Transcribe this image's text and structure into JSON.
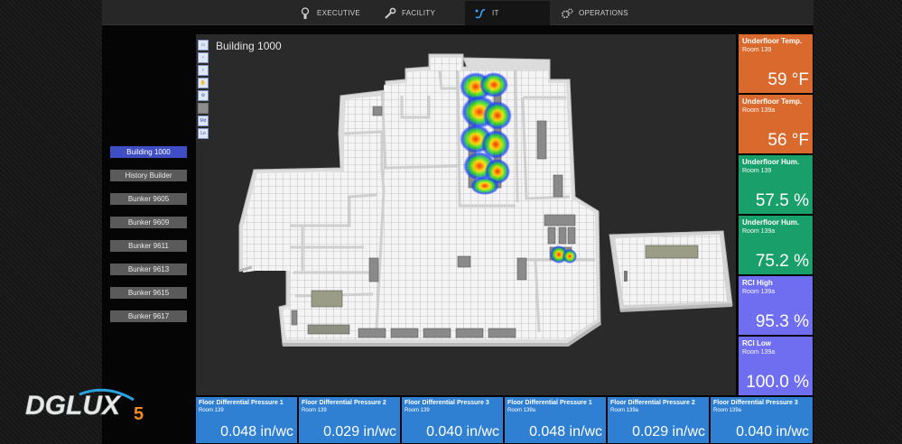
{
  "nav": {
    "tabs": [
      {
        "label": "EXECUTIVE",
        "icon": "lightbulb-icon"
      },
      {
        "label": "FACILITY",
        "icon": "wrench-icon"
      },
      {
        "label": "IT",
        "icon": "network-icon"
      },
      {
        "label": "OPERATIONS",
        "icon": "gears-icon"
      }
    ],
    "active": "IT"
  },
  "sidebar": {
    "items": [
      "Building 1000",
      "History Builder",
      "Bunker 9605",
      "Bunker 9609",
      "Bunker 9611",
      "Bunker 9613",
      "Bunker 9615",
      "Bunker 9617"
    ],
    "active": "Building 1000"
  },
  "viewer": {
    "title": "Building 1000",
    "tools": [
      "save-icon",
      "pin-icon",
      "pin-icon",
      "hand-icon",
      "gear-icon",
      "",
      "Md",
      "Lo"
    ]
  },
  "sensors": [
    {
      "title": "Underfloor Temp.",
      "room": "Room 139",
      "value": "59 °F",
      "color": "#d9692c"
    },
    {
      "title": "Underfloor Temp.",
      "room": "Room 139a",
      "value": "56 °F",
      "color": "#d9692c"
    },
    {
      "title": "Underfloor Hum.",
      "room": "Room 139",
      "value": "57.5 %",
      "color": "#19a06a"
    },
    {
      "title": "Underfloor Hum.",
      "room": "Room 139a",
      "value": "75.2 %",
      "color": "#19a06a"
    },
    {
      "title": "RCI High",
      "room": "Room 139a",
      "value": "95.3 %",
      "color": "#6f6df0"
    },
    {
      "title": "RCI Low",
      "room": "Room 139a",
      "value": "100.0 %",
      "color": "#6f6df0"
    }
  ],
  "pressures": [
    {
      "title": "Floor Differential Pressure 1",
      "room": "Room 139",
      "value": "0.048 in/wc"
    },
    {
      "title": "Floor Differential Pressure 2",
      "room": "Room 139",
      "value": "0.029 in/wc"
    },
    {
      "title": "Floor Differential Pressure 3",
      "room": "Room 139",
      "value": "0.040 in/wc"
    },
    {
      "title": "Floor Differential Pressure 1",
      "room": "Room 139a",
      "value": "0.048 in/wc"
    },
    {
      "title": "Floor Differential Pressure 2",
      "room": "Room 139a",
      "value": "0.029 in/wc"
    },
    {
      "title": "Floor Differential Pressure 3",
      "room": "Room 139a",
      "value": "0.040 in/wc"
    }
  ],
  "logo": {
    "text": "DGLUX",
    "version": "5"
  }
}
